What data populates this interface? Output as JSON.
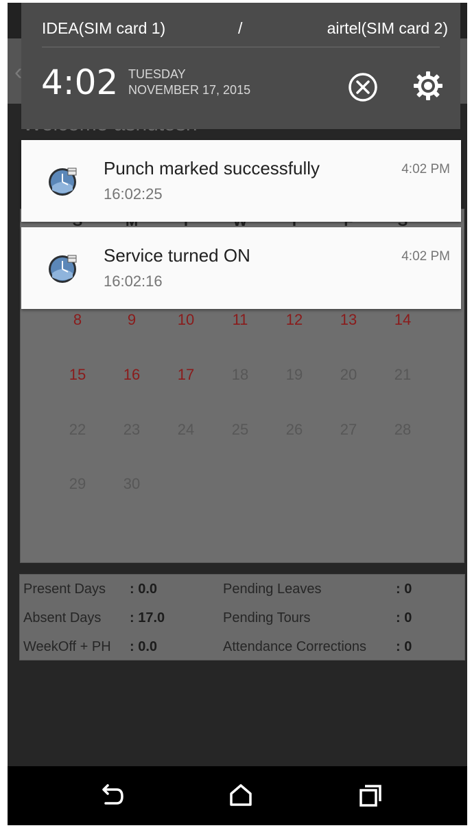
{
  "status": {
    "sim1": "IDEA(SIM card 1)",
    "separator": "/",
    "sim2": "airtel(SIM card 2)",
    "clock": "4:02",
    "weekday": "TUESDAY",
    "date": "NOVEMBER 17, 2015",
    "dismiss_icon": "close-circle-icon",
    "settings_icon": "gear-icon"
  },
  "notifications": [
    {
      "title": "Punch marked successfully",
      "subtitle": "16:02:25",
      "time": "4:02 PM",
      "icon": "attendance-app-icon"
    },
    {
      "title": "Service turned ON",
      "subtitle": "16:02:16",
      "time": "4:02 PM",
      "icon": "attendance-app-icon"
    }
  ],
  "background_app": {
    "back_icon": "back-arrow-icon",
    "welcome": "Welcome ashutosh",
    "calendar": {
      "weekdays": [
        "S",
        "M",
        "T",
        "W",
        "T",
        "F",
        "S"
      ],
      "weeks": [
        [
          "8",
          "9",
          "10",
          "11",
          "12",
          "13",
          "14"
        ],
        [
          "15",
          "16",
          "17",
          "18",
          "19",
          "20",
          "21"
        ],
        [
          "22",
          "23",
          "24",
          "25",
          "26",
          "27",
          "28"
        ],
        [
          "29",
          "30"
        ]
      ],
      "highlighted_days": [
        "8",
        "9",
        "10",
        "11",
        "12",
        "13",
        "14",
        "15",
        "16",
        "17"
      ],
      "highlight_color": "#8a1b1b"
    },
    "summary": {
      "present_label": "Present Days",
      "present_value": ": 0.0",
      "absent_label": "Absent Days",
      "absent_value": ": 17.0",
      "weekoff_label": "WeekOff + PH",
      "weekoff_value": ": 0.0",
      "leaves_label": "Pending Leaves",
      "leaves_value": ": 0",
      "tours_label": "Pending Tours",
      "tours_value": ": 0",
      "corrections_label": "Attendance Corrections",
      "corrections_value": ": 0"
    }
  },
  "navbar": {
    "back_icon": "back-icon",
    "home_icon": "home-icon",
    "recents_icon": "recents-icon"
  }
}
